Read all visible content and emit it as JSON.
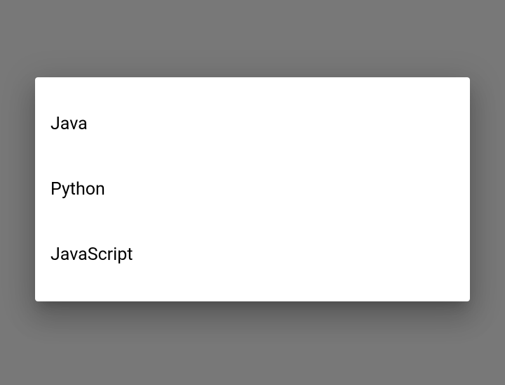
{
  "dialog": {
    "items": [
      {
        "label": "Java"
      },
      {
        "label": "Python"
      },
      {
        "label": "JavaScript"
      }
    ]
  }
}
